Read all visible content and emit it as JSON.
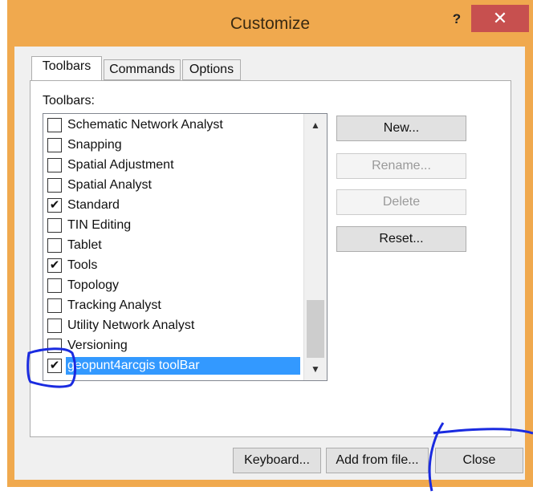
{
  "window": {
    "title": "Customize",
    "help_label": "?",
    "close_label": "✕"
  },
  "tabs": [
    {
      "label": "Toolbars",
      "active": true
    },
    {
      "label": "Commands",
      "active": false
    },
    {
      "label": "Options",
      "active": false
    }
  ],
  "toolbars_label": "Toolbars:",
  "list": {
    "items": [
      {
        "label": "Schematic Network Analyst",
        "checked": false
      },
      {
        "label": "Snapping",
        "checked": false
      },
      {
        "label": "Spatial Adjustment",
        "checked": false
      },
      {
        "label": "Spatial Analyst",
        "checked": false
      },
      {
        "label": "Standard",
        "checked": true
      },
      {
        "label": "TIN Editing",
        "checked": false
      },
      {
        "label": "Tablet",
        "checked": false
      },
      {
        "label": "Tools",
        "checked": true
      },
      {
        "label": "Topology",
        "checked": false
      },
      {
        "label": "Tracking Analyst",
        "checked": false
      },
      {
        "label": "Utility Network Analyst",
        "checked": false
      },
      {
        "label": "Versioning",
        "checked": false
      },
      {
        "label": "geopunt4arcgis toolBar",
        "checked": true,
        "selected": true
      }
    ],
    "check_glyph": "✔",
    "scroll_up": "▲",
    "scroll_down": "▼"
  },
  "side_buttons": {
    "new": "New...",
    "rename": "Rename...",
    "delete": "Delete",
    "reset": "Reset..."
  },
  "bottom_buttons": {
    "keyboard": "Keyboard...",
    "add_from_file": "Add from file...",
    "close": "Close"
  },
  "colors": {
    "title_bar": "#f0a94e",
    "close_button": "#c7504f",
    "selection": "#3399ff",
    "annotation": "#1a2be0"
  }
}
